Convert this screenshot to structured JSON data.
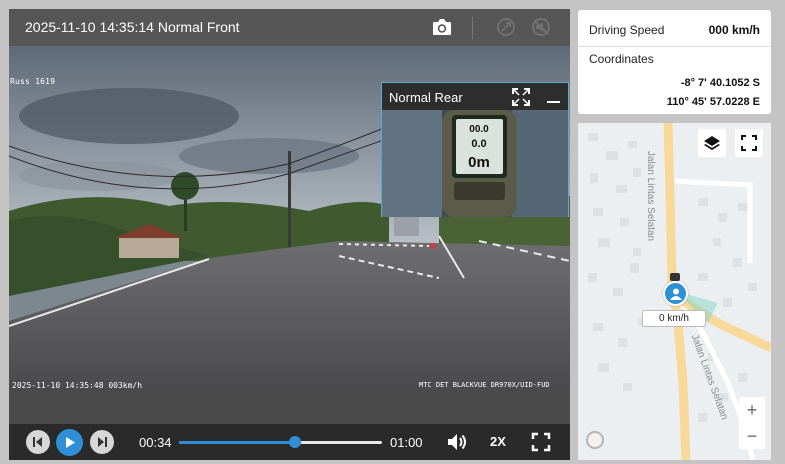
{
  "video": {
    "title": "2025-11-10 14:35:14 Normal Front",
    "front_osd_top": "Russ 1619",
    "front_osd_bottom_left": "2025-11-10 14:35:48 003km/h",
    "front_osd_bottom_right": "MTC DET BLACKVUE DR970X/UID-FUD",
    "rear": {
      "title": "Normal Rear",
      "device_readout": [
        "00.0",
        "0.0",
        "0m"
      ]
    },
    "icons": {
      "snapshot": "camera-icon",
      "gps": "satellite-icon",
      "noise": "sound-off-icon"
    }
  },
  "controls": {
    "time_current": "00:34",
    "time_total": "01:00",
    "progress": 0.57,
    "speed": "2X",
    "icons": [
      "previous-icon",
      "play-icon",
      "next-icon",
      "volume-icon",
      "fullscreen-icon"
    ]
  },
  "info": {
    "speed_label": "Driving Speed",
    "speed_value": "000 km/h",
    "coord_label": "Coordinates",
    "latitude": "-8° 7' 40.1052 S",
    "longitude": "110° 45' 57.0228 E"
  },
  "map": {
    "road_label_1": "Jalan Lintas Selatan",
    "road_label_2": "Jalan Lintas Selatan",
    "speed_chip": "0 km/h",
    "zoom_in": "+",
    "zoom_out": "−",
    "colors": {
      "accent": "#2e8fd6",
      "main_road": "#f8d99a",
      "land": "#eceff1"
    }
  }
}
